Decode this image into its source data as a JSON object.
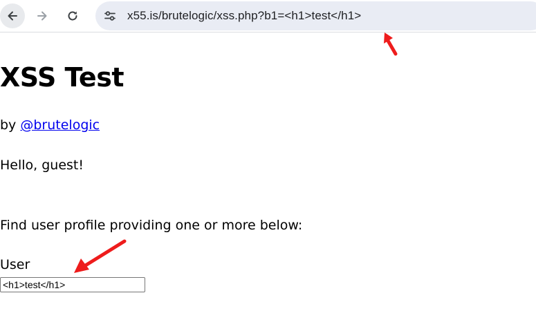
{
  "browser": {
    "url": "x55.is/brutelogic/xss.php?b1=<h1>test</h1>",
    "back_icon": "arrow-left-icon",
    "forward_icon": "arrow-right-icon",
    "reload_icon": "reload-icon",
    "site_info_icon": "tune-icon"
  },
  "page": {
    "title": "XSS Test",
    "byline_prefix": "by ",
    "author_link": "@brutelogic",
    "greeting": "Hello, guest!",
    "instructions": "Find user profile providing one or more below:",
    "user_label": "User",
    "user_input_value": "<h1>test</h1>"
  },
  "annotations": {
    "arrow_color": "#ee1c1c"
  }
}
